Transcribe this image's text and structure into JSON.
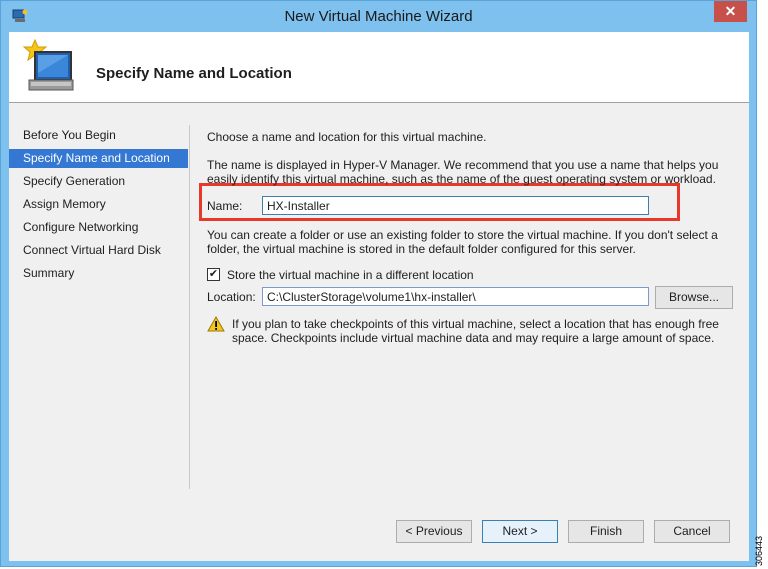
{
  "window": {
    "title": "New Virtual Machine Wizard",
    "close_glyph": "✕"
  },
  "header": {
    "page_title": "Specify Name and Location",
    "icon": "virtual-machine-wizard-icon"
  },
  "nav": {
    "items": [
      {
        "label": "Before You Begin",
        "active": false
      },
      {
        "label": "Specify Name and Location",
        "active": true
      },
      {
        "label": "Specify Generation",
        "active": false
      },
      {
        "label": "Assign Memory",
        "active": false
      },
      {
        "label": "Configure Networking",
        "active": false
      },
      {
        "label": "Connect Virtual Hard Disk",
        "active": false
      },
      {
        "label": "Summary",
        "active": false
      }
    ]
  },
  "content": {
    "intro": "Choose a name and location for this virtual machine.",
    "name_help": "The name is displayed in Hyper-V Manager. We recommend that you use a name that helps you easily identify this virtual machine, such as the name of the guest operating system or workload.",
    "name_label": "Name:",
    "name_value": "HX-Installer",
    "folder_help": "You can create a folder or use an existing folder to store the virtual machine. If you don't select a folder, the virtual machine is stored in the default folder configured for this server.",
    "store_checkbox_label": "Store the virtual machine in a different location",
    "store_checked": true,
    "location_label": "Location:",
    "location_value": "C:\\ClusterStorage\\volume1\\hx-installer\\",
    "browse_label": "Browse...",
    "warning_text": "If you plan to take checkpoints of this virtual machine, select a location that has enough free space. Checkpoints include virtual machine data and may require a large amount of space.",
    "warning_icon": "warning-icon"
  },
  "footer": {
    "previous_label": "< Previous",
    "next_label": "Next >",
    "finish_label": "Finish",
    "cancel_label": "Cancel"
  },
  "side_code": "306443",
  "colors": {
    "chrome": "#7ec0ee",
    "nav_active": "#3478d3",
    "highlight": "#e8372b"
  }
}
